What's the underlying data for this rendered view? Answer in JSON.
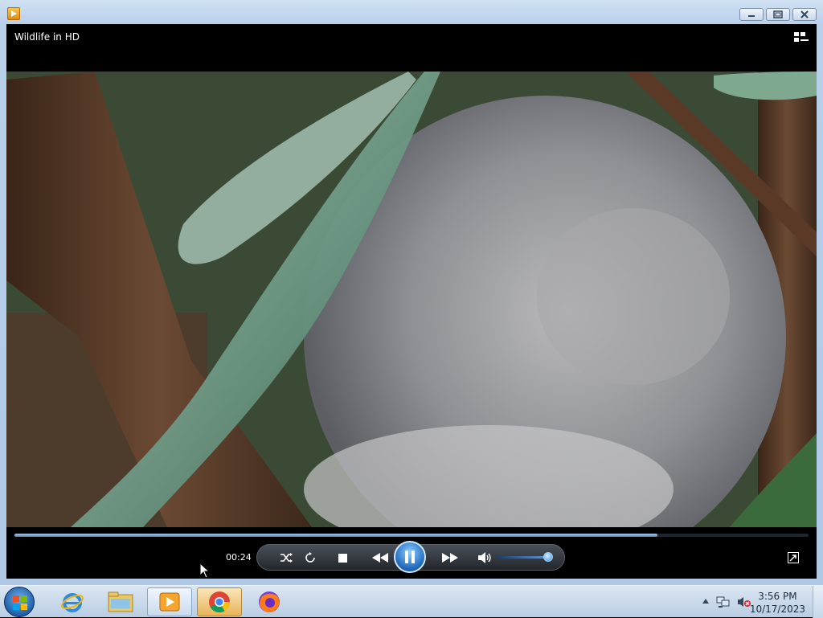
{
  "window": {
    "video_title": "Wildlife in HD"
  },
  "player": {
    "time": "00:24",
    "progress_fraction": 0.81,
    "volume_fraction": 0.9,
    "state": "playing"
  },
  "taskbar": {
    "apps": [
      {
        "name": "internet-explorer-icon"
      },
      {
        "name": "file-explorer-icon"
      },
      {
        "name": "windows-media-player-icon"
      },
      {
        "name": "chrome-icon"
      },
      {
        "name": "firefox-icon"
      }
    ],
    "clock_time": "3:56 PM",
    "clock_date": "10/17/2023"
  },
  "colors": {
    "accent": "#2a74c6",
    "taskbar": "#c9daed"
  }
}
